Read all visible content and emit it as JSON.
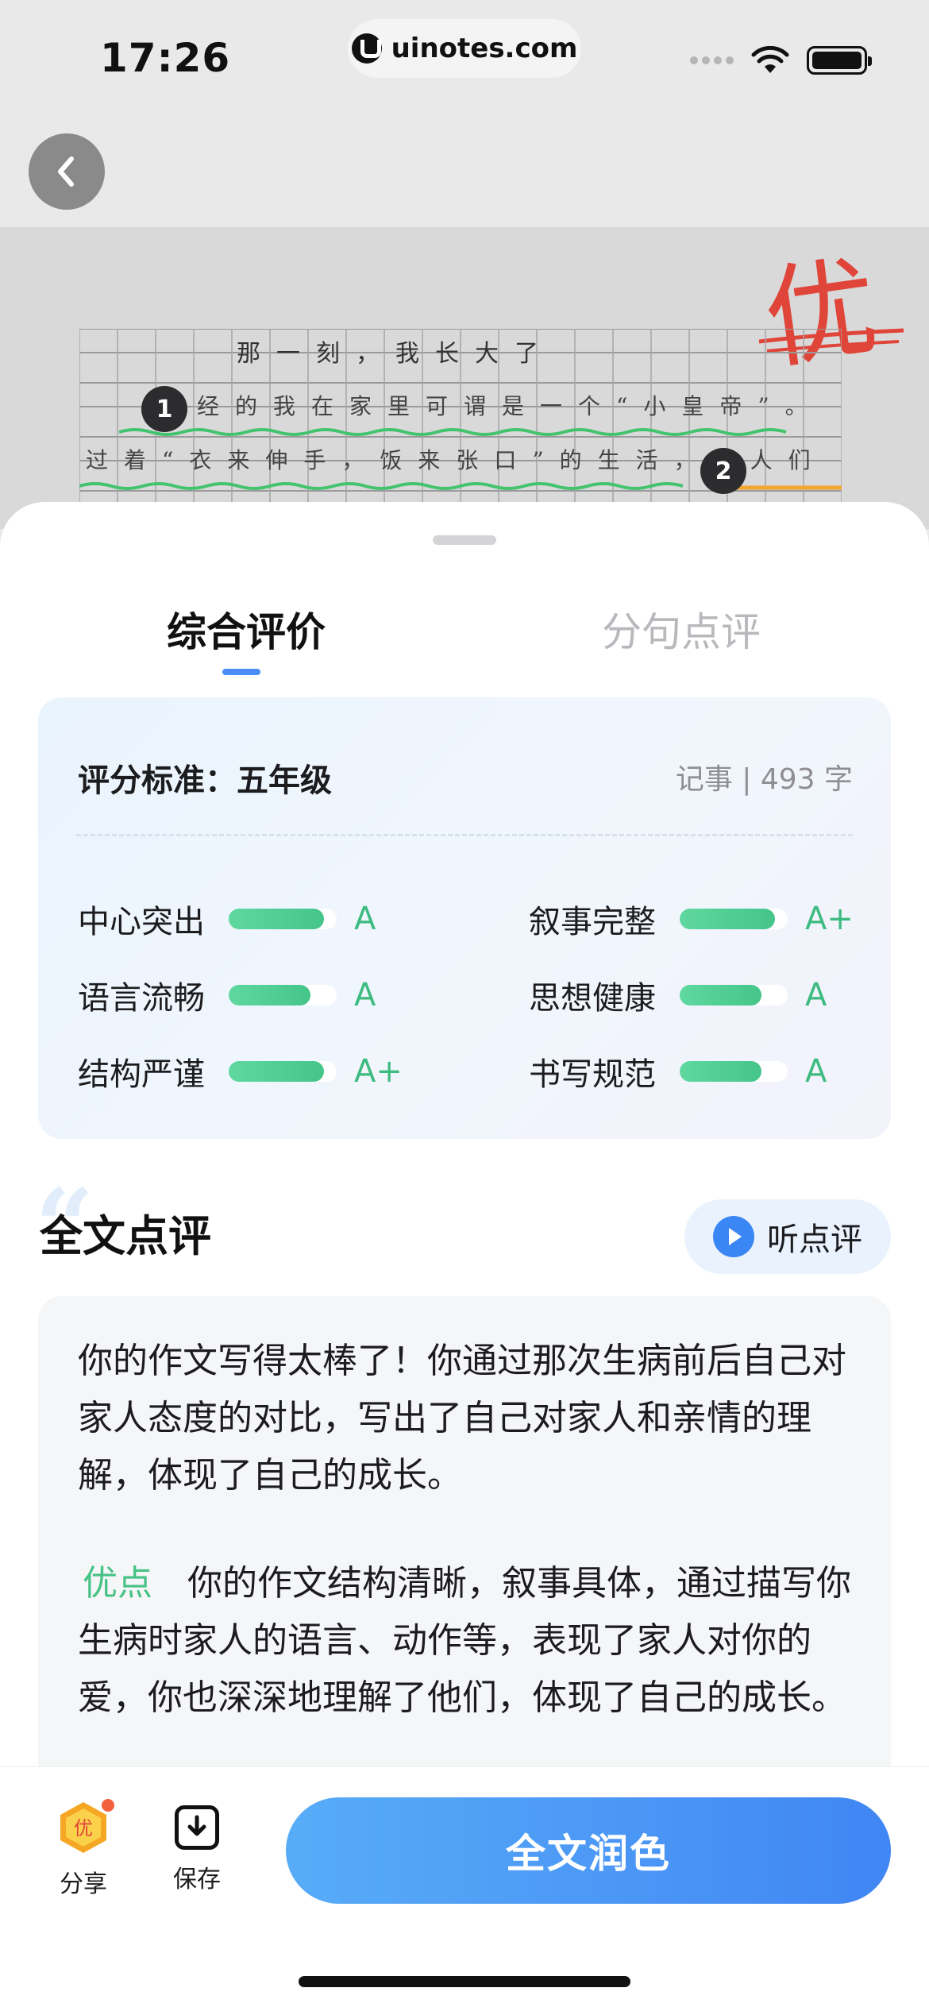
{
  "status_bar": {
    "time": "17:26",
    "url": "uinotes.com"
  },
  "essay": {
    "grade_mark": "优",
    "title_line": "那一刻，我长大了",
    "line1": "曾经的我在家里可谓是一个“小皇帝”。",
    "line2": "过着“衣来伸手，饭来张口”的生活，大人们",
    "annotation_1": "1",
    "annotation_2": "2"
  },
  "tabs": [
    {
      "label": "综合评价",
      "active": true
    },
    {
      "label": "分句点评",
      "active": false
    }
  ],
  "score_card": {
    "standard_label": "评分标准：五年级",
    "meta": "记事 | 493 字",
    "metrics": [
      {
        "name": "中心突出",
        "grade": "A",
        "level": 0.88
      },
      {
        "name": "叙事完整",
        "grade": "A+",
        "level": 0.88
      },
      {
        "name": "语言流畅",
        "grade": "A",
        "level": 0.76
      },
      {
        "name": "思想健康",
        "grade": "A",
        "level": 0.76
      },
      {
        "name": "结构严谨",
        "grade": "A+",
        "level": 0.88
      },
      {
        "name": "书写规范",
        "grade": "A",
        "level": 0.76
      }
    ]
  },
  "review": {
    "title": "全文点评",
    "listen_label": "听点评",
    "summary": "你的作文写得太棒了！你通过那次生病前后自己对家人态度的对比，写出了自己对家人和亲情的理解，体现了自己的成长。",
    "merit_label": "优点",
    "merit_text": "你的作文结构清晰，叙事具体，通过描写你生病时家人的语言、动作等，表现了家人对你的爱，你也深深地理解了他们，体现了自己的成长。"
  },
  "bottom_bar": {
    "share_label": "分享",
    "save_label": "保存",
    "polish_label": "全文润色",
    "share_badge": "优"
  },
  "colors": {
    "accent": "#4a8df7",
    "grade_green": "#3dbb80",
    "mark_red": "#e0453a"
  }
}
